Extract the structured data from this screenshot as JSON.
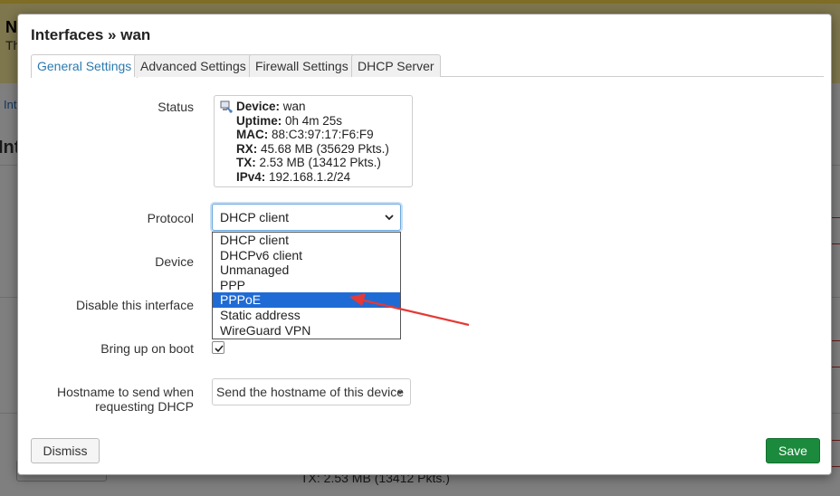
{
  "background": {
    "banner_title": "N",
    "banner_sub": "Th",
    "crumb": "Int",
    "heading": "Int",
    "tx_line": "TX: 2.53 MB (13412 Pkts.)"
  },
  "modal": {
    "title": "Interfaces » wan",
    "tabs": [
      {
        "label": "General Settings",
        "active": true
      },
      {
        "label": "Advanced Settings",
        "active": false
      },
      {
        "label": "Firewall Settings",
        "active": false
      },
      {
        "label": "DHCP Server",
        "active": false
      }
    ],
    "status": {
      "label": "Status",
      "icon": "network-device-icon",
      "device_key": "Device:",
      "device_val": "wan",
      "uptime_key": "Uptime:",
      "uptime_val": "0h 4m 25s",
      "mac_key": "MAC:",
      "mac_val": "88:C3:97:17:F6:F9",
      "rx_key": "RX:",
      "rx_val": "45.68 MB (35629 Pkts.)",
      "tx_key": "TX:",
      "tx_val": "2.53 MB (13412 Pkts.)",
      "ipv4_key": "IPv4:",
      "ipv4_val": "192.168.1.2/24"
    },
    "protocol": {
      "label": "Protocol",
      "selected": "DHCP client",
      "options": [
        "DHCP client",
        "DHCPv6 client",
        "Unmanaged",
        "PPP",
        "PPPoE",
        "Static address",
        "WireGuard VPN"
      ],
      "highlighted": "PPPoE"
    },
    "device_label": "Device",
    "disable_label": "Disable this interface",
    "bring_up": {
      "label": "Bring up on boot",
      "checked": true
    },
    "hostname": {
      "label_line1": "Hostname to send when",
      "label_line2": "requesting DHCP",
      "value": "Send the hostname of this device"
    },
    "dismiss_label": "Dismiss",
    "save_label": "Save"
  },
  "colors": {
    "accent": "#2a7ab0",
    "save": "#1c8a3c",
    "dropdown_highlight": "#1f6bd6",
    "annotation_arrow": "#e53935",
    "banner": "#fcec9a"
  }
}
